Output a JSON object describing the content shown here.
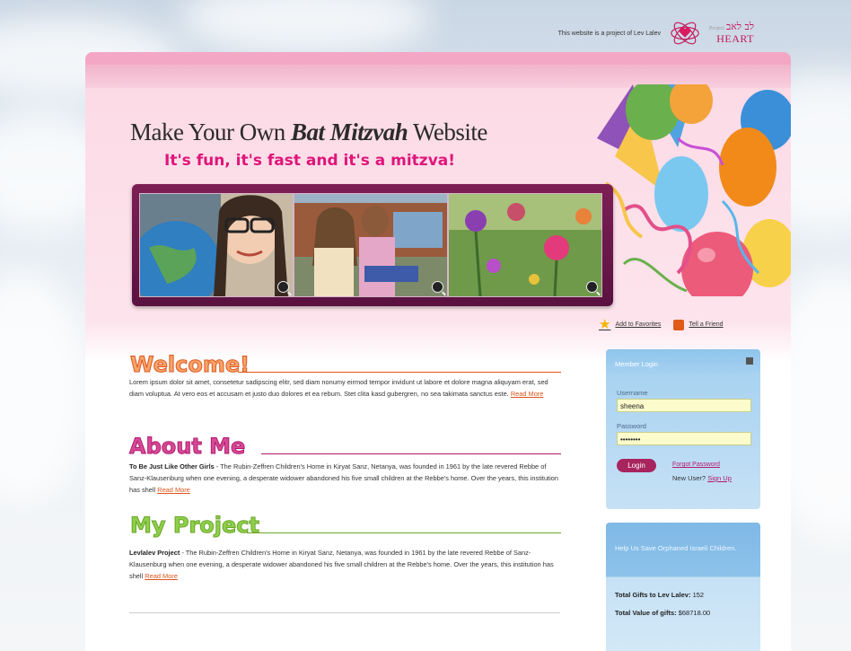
{
  "topbar": {
    "project_text": "This website is a project of Lev Lalev",
    "logo": {
      "small": "Project",
      "hebrew": "לב לאב",
      "heart": "HEART"
    }
  },
  "header": {
    "headline_pre": "Make Your Own ",
    "headline_em": "Bat Mitzvah",
    "headline_post": " Website",
    "tagline": "It's fun, it's fast and it's a mitzva!"
  },
  "actions": {
    "favorites": "Add to Favorites",
    "friend": "Tell a Friend"
  },
  "sections": {
    "welcome": {
      "title": "Welcome!",
      "text": "Lorem ipsum dolor sit amet, consetetur sadipscing elitr, sed diam nonumy eirmod tempor invidunt ut labore et dolore magna aliquyam erat, sed diam voluptua. At vero eos et accusam et justo duo dolores et ea rebum. Stet clita kasd gubergren, no sea takimata sanctus este.",
      "more": "Read More"
    },
    "about": {
      "title": "About Me",
      "lead": "To Be Just Like Other Girls",
      "text": " - The Rubin-Zeffren Children's Home in Kiryat Sanz, Netanya, was founded in 1961 by the late revered Rebbe of Sanz-Klausenburg when one evening, a desperate widower abandoned his five small children at the Rebbe's home. Over the years, this institution has shell",
      "more": "Read More"
    },
    "project": {
      "title": "My Project",
      "lead": "Levlalev Project",
      "text": " - The Rubin-Zeffren Children's Home in Kiryat Sanz, Netanya, was founded in 1961 by the late revered Rebbe of Sanz-Klausenburg when one evening, a desperate widower abandoned his five small children at the Rebbe's home. Over the years, this institution has shell",
      "more": "Read More"
    }
  },
  "login": {
    "title": "Member Login",
    "username_label": "Username",
    "username_value": "sheena",
    "password_label": "Password",
    "password_value": "••••••••",
    "login_button": "Login",
    "forgot": "Forgot Password",
    "new_user": "New User? ",
    "sign_up": "Sign Up"
  },
  "save": {
    "message": "Help Us Save Orphaned Israeli Children.",
    "gifts_label": "Total Gifts to Lev Lalev:",
    "gifts_value": "152",
    "value_label": "Total Value of gifts:",
    "value_value": "$68718.00"
  },
  "colors": {
    "pink_band": "#f3a7c5",
    "tagline": "#e0157a",
    "welcome": "#e05519",
    "about": "#b21a6e",
    "project": "#6aa428",
    "login_button": "#a8245e",
    "panel": "#8ec4ec"
  }
}
